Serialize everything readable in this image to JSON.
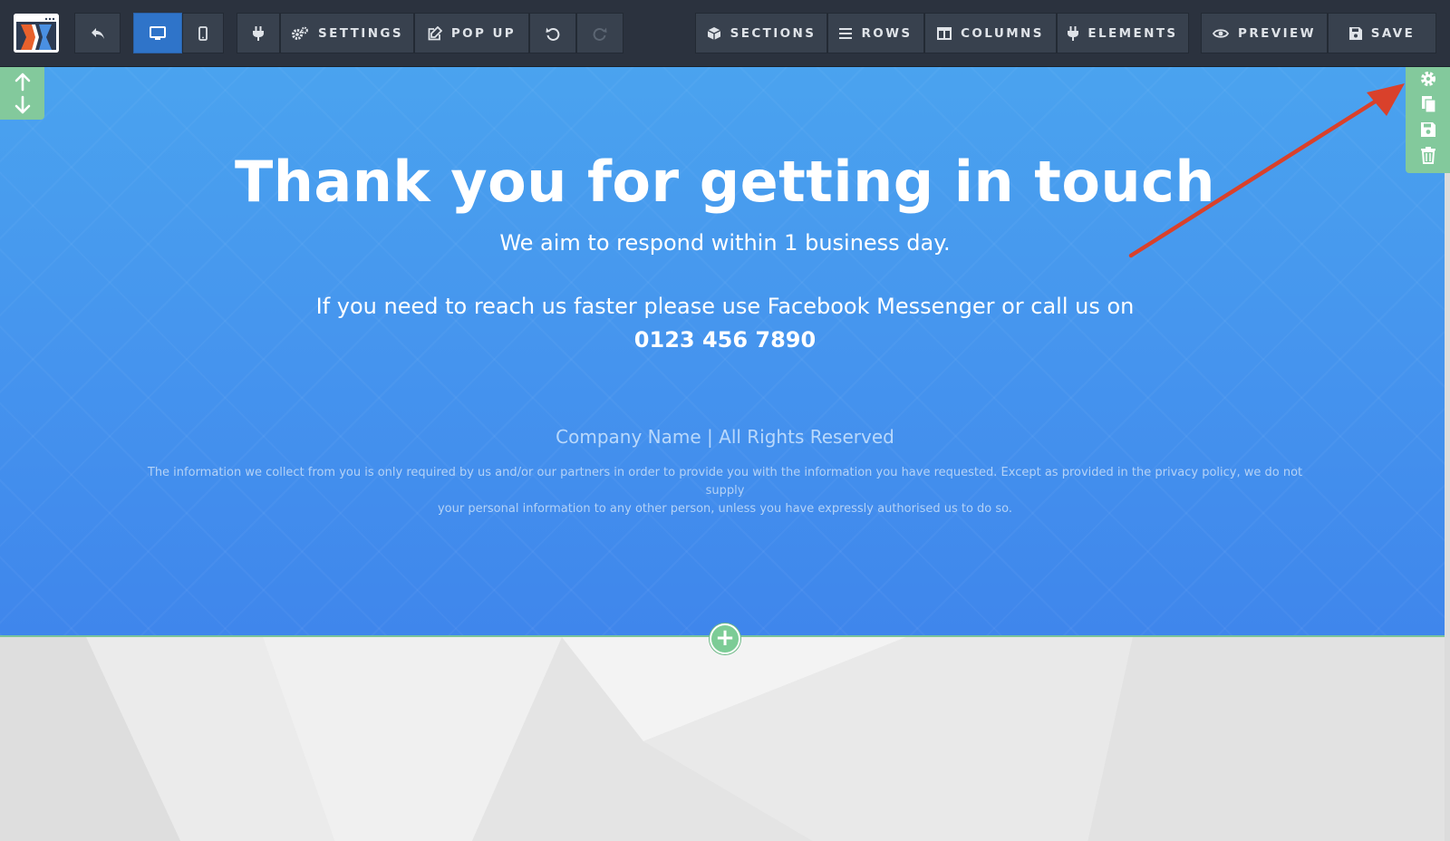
{
  "toolbar": {
    "logo": "clickfunnels-logo",
    "undo_back_icon": "reply-arrow-icon",
    "view_desktop_icon": "desktop-icon",
    "view_mobile_icon": "mobile-icon",
    "plug_icon": "plug-icon",
    "settings_label": "SETTINGS",
    "popup_label": "POP UP",
    "undo_icon": "undo-icon",
    "redo_icon": "redo-icon",
    "sections_label": "SECTIONS",
    "rows_label": "ROWS",
    "columns_label": "COLUMNS",
    "elements_label": "ELEMENTS",
    "preview_label": "PREVIEW",
    "save_label": "SAVE"
  },
  "section_tools": {
    "move_up_icon": "arrow-up-icon",
    "move_down_icon": "arrow-down-icon",
    "settings_icon": "gear-icon",
    "clone_icon": "copy-icon",
    "save_icon": "floppy-disk-icon",
    "delete_icon": "trash-icon"
  },
  "hero": {
    "title": "Thank you for getting in touch",
    "subtitle": "We aim to respond within 1 business day.",
    "contact_text": "If you need to reach us faster please use Facebook Messenger or call us on",
    "phone": "0123 456 7890",
    "company": "Company Name | All Rights Reserved",
    "disclaimer_line1": "The information we collect from you is only required by us and/or our partners in order to provide you with the information you have requested. Except as provided in the privacy policy, we do not supply",
    "disclaimer_line2": "your personal information to any other person, unless you have expressly authorised us to do so."
  },
  "add_section_label": "+",
  "colors": {
    "toolbar_bg": "#2b323e",
    "active_button": "#2f74c9",
    "hero_blue": "#4696ee",
    "tool_green": "#83c99c",
    "annotation_red": "#d9412b"
  }
}
